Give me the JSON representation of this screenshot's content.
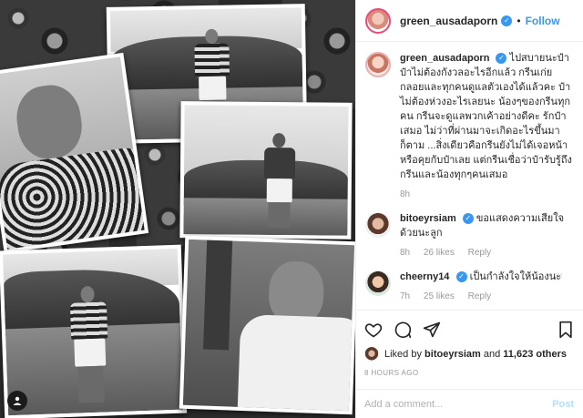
{
  "header": {
    "username": "green_ausadaporn",
    "verified_mark": "✓",
    "separator": "•",
    "follow_label": "Follow"
  },
  "post": {
    "author": "green_ausadaporn",
    "caption": "ไปสบายนะป๋า ป๋าไม่ต้องกังวลอะไรอีกแล้ว กรีนเก่ย กลอยและทุกคนดูแลตัวเองได้แล้วคะ ป๋าไม่ต้องห่วงอะไรเลยนะ น้องๆของกรีนทุกคน กรีนจะดูแลพวกเค้าอย่างดีคะ รักป๋าเสมอ ไม่ว่าที่ผ่านมาจะเกิดอะไรขึ้นมาก็ตาม ...สิ่งเดียวคือกรีนยังไม่ได้เจอหน้าหรือคุยกับป๋าเลย แต่กรีนเชื่อว่าป๋ารับรู้ถึงกรีนและน้องทุกๆคนเสมอ",
    "time_ago": "8h"
  },
  "comments": [
    {
      "username": "bitoeyrsiam",
      "text": "ขอแสดงความเสียใจด้วยนะลูก",
      "time_ago": "8h",
      "likes": "26 likes",
      "reply_label": "Reply"
    },
    {
      "username": "cheerny14",
      "text": "เป็นกำลังใจให้น้องนะ",
      "time_ago": "7h",
      "likes": "25 likes",
      "reply_label": "Reply"
    }
  ],
  "likes": {
    "prefix": "Liked by",
    "user": "bitoeyrsiam",
    "conjunction": "and",
    "others": "11,623 others"
  },
  "timestamp": "8 HOURS AGO",
  "add_comment": {
    "placeholder": "Add a comment...",
    "post_label": "Post"
  },
  "icons": {
    "like": "heart-icon",
    "comment": "comment-icon",
    "share": "share-icon",
    "save": "bookmark-icon",
    "comment_like": "heart-small-icon",
    "camera": "camera-icon"
  },
  "colors": {
    "accent": "#3897f0",
    "muted": "#999999",
    "text": "#262626"
  }
}
